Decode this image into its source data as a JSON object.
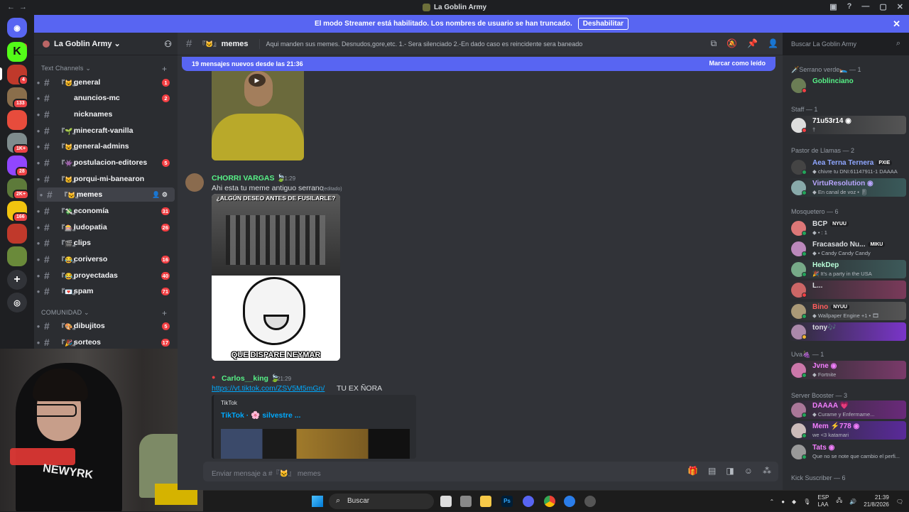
{
  "window": {
    "title": "La Goblin Army",
    "controls": [
      "—",
      "▢",
      "✕"
    ]
  },
  "banner": {
    "text": "El modo Streamer está habilitado. Los nombres de usuario se han truncado.",
    "button": "Deshabilitar",
    "close": "✕"
  },
  "guilds": [
    {
      "label": "524",
      "color": "#5865f2"
    },
    {
      "label": "K",
      "color": "#53fc18"
    },
    {
      "label": "4",
      "color": "#c0392b"
    },
    {
      "label": "133",
      "color": "#8a6e4b"
    },
    {
      "label": "",
      "color": "#e74c3c"
    },
    {
      "label": "1K+",
      "color": "#7f8c8d"
    },
    {
      "label": "28",
      "color": "#9146ff"
    },
    {
      "label": "2K+",
      "color": "#5d7a3a"
    },
    {
      "label": "166",
      "color": "#f1c40f"
    },
    {
      "label": "",
      "color": "#c0392b"
    },
    {
      "label": "",
      "color": "#6a8a3a"
    }
  ],
  "server": {
    "name": "La Goblin Army ⌄",
    "categories": [
      {
        "name": "Text Channels ⌄"
      },
      {
        "name": "COMUNIDAD ⌄"
      }
    ],
    "channels": [
      {
        "emoji": "『😺』",
        "name": "general",
        "badge": "1",
        "bold": true
      },
      {
        "emoji": "",
        "name": "anuncios-mc",
        "badge": "2",
        "bold": true
      },
      {
        "emoji": "",
        "name": "nicknames",
        "badge": "",
        "bold": true
      },
      {
        "emoji": "『🌱』",
        "name": "minecraft-vanilla",
        "badge": "",
        "bold": true
      },
      {
        "emoji": "『😺』",
        "name": "general-admins",
        "badge": "",
        "bold": true
      },
      {
        "emoji": "『👾』",
        "name": "postulacion-editores",
        "badge": "5",
        "bold": true
      },
      {
        "emoji": "『🐱』",
        "name": "porqui-mi-banearon",
        "badge": "",
        "bold": true
      },
      {
        "emoji": "『🐱』",
        "name": "memes",
        "badge": "",
        "bold": true,
        "active": true
      },
      {
        "emoji": "『💸』",
        "name": "economía",
        "badge": "31",
        "bold": true
      },
      {
        "emoji": "『🎰』",
        "name": "ludopatia",
        "badge": "26",
        "bold": true
      },
      {
        "emoji": "『🎬』",
        "name": "clips",
        "badge": "",
        "bold": true
      },
      {
        "emoji": "『😂』",
        "name": "coriverso",
        "badge": "16",
        "bold": true
      },
      {
        "emoji": "『😂』",
        "name": "proyectadas",
        "badge": "40",
        "bold": true
      },
      {
        "emoji": "『💌』",
        "name": "spam",
        "badge": "71",
        "bold": true
      },
      {
        "emoji": "『🎨』",
        "name": "dibujitos",
        "badge": "5",
        "bold": true
      },
      {
        "emoji": "『🎉』",
        "name": "sorteos",
        "badge": "17",
        "bold": true
      }
    ]
  },
  "chat": {
    "channel_emoji": "『🐱』",
    "channel": "memes",
    "topic": "Aqui manden sus memes. Desnudos,gore,etc. 1.- Sera silenciado 2.-En dado caso es reincidente sera baneado",
    "search_placeholder": "Buscar La Goblin Army",
    "new_messages": "19 mensajes nuevos desde las 21:36",
    "mark_read": "Marcar como leído",
    "messages": [
      {
        "author": "CHORRI VARGAS 🍃",
        "time": "21:29",
        "text": "Ahi esta tu meme antiguo serrano",
        "edited": "(editado)"
      },
      {
        "author": "Carlos__king 🍃",
        "time": "21:29",
        "link": "https://vt.tiktok.com/ZSV5M5mGn/",
        "text": "TU EX ÑORA"
      }
    ],
    "meme_top": "¿ALGÚN DESEO ANTES DE FUSILARLE?",
    "meme_bottom": "QUE DISPARE NEYMAR",
    "embed": {
      "provider": "TikTok",
      "title": "TikTok · 🌸 silvestre ..."
    },
    "composer_placeholder": "Enviar mensaje a #『🐱』 memes"
  },
  "members": {
    "groups": [
      {
        "name": "🗡️Serrano verde🛌 — 1"
      },
      {
        "name": "Staff — 1"
      },
      {
        "name": "Pastor de Llamas — 2"
      },
      {
        "name": "Mosquetero — 6"
      },
      {
        "name": "Uva🍇 — 1"
      },
      {
        "name": "Server Booster — 3"
      },
      {
        "name": "Kick Suscriber — 6"
      }
    ],
    "list": [
      {
        "name": "Goblinciano",
        "status": "",
        "color": "#57f287",
        "tag": ""
      },
      {
        "name": "71u53r14 ◉",
        "status": "†",
        "color": "#ffffff",
        "tag": ""
      },
      {
        "name": "Aea Terna Ternera",
        "status": "◆ chivre tu DNI:61147911-1 DAAAA",
        "color": "#8fa6ff",
        "tag": "PXIE"
      },
      {
        "name": "VirtuResolution ◉",
        "status": "◆ En canal de voz • 🎚",
        "color": "#b9a6ff",
        "tag": ""
      },
      {
        "name": "BCP",
        "status": "◆ • : 1",
        "color": "#dbdee1",
        "tag": "NYUU"
      },
      {
        "name": "Fracasado Nu...",
        "status": "◆ • Candy Candy Candy",
        "color": "#dbdee1",
        "tag": "MIKU"
      },
      {
        "name": "HekDep",
        "status": "🎉 It's a party in the USA",
        "color": "#b9ffd9",
        "tag": ""
      },
      {
        "name": "L...",
        "status": "",
        "color": "#dbdee1",
        "tag": ""
      },
      {
        "name": "Bino",
        "status": "◆ Wallpaper Engine +1 • 🎞",
        "color": "#ff5c5c",
        "tag": "NYUU"
      },
      {
        "name": "tony🎶",
        "status": "",
        "color": "#dbdee1",
        "tag": ""
      },
      {
        "name": "Jvne ◉",
        "status": "◆ Fortnite",
        "color": "#f47fff",
        "tag": ""
      },
      {
        "name": "DAAAA 💗",
        "status": "◆ Curame y Enfermame...",
        "color": "#f47fff",
        "tag": ""
      },
      {
        "name": "Mem ⚡778 ◉",
        "status": "we <3 katamari",
        "color": "#f47fff",
        "tag": ""
      },
      {
        "name": "Tats ◉",
        "status": "Que no se note que cambio el perfi...",
        "color": "#f47fff",
        "tag": ""
      }
    ]
  },
  "taskbar": {
    "search": "Buscar",
    "lang": "ESP\nLAA",
    "time": "21:39",
    "date": "21/8/2026"
  },
  "webcam": {
    "shirt_text": "NEWYRK"
  }
}
